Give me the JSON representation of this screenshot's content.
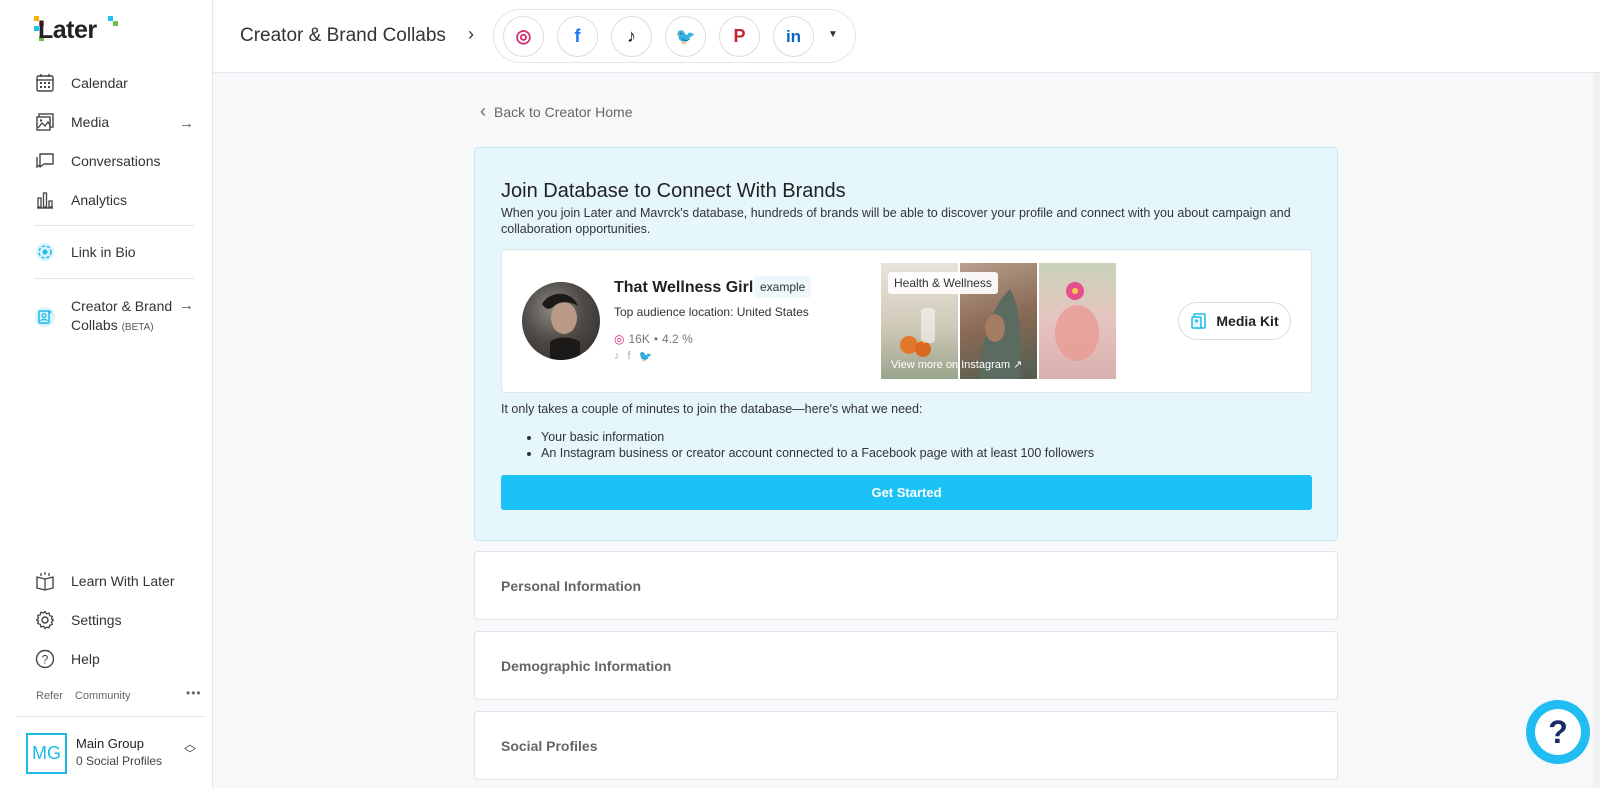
{
  "app": {
    "logo": "Later"
  },
  "sidebar": {
    "items": [
      {
        "label": "Calendar",
        "icon": "calendar-icon"
      },
      {
        "label": "Media",
        "icon": "media-icon"
      },
      {
        "label": "Conversations",
        "icon": "conversations-icon"
      },
      {
        "label": "Analytics",
        "icon": "analytics-icon"
      },
      {
        "label": "Link in Bio",
        "icon": "link-in-bio-icon"
      },
      {
        "label": "Creator & Brand",
        "label2": "Collabs",
        "badge": "(BETA)",
        "icon": "creator-collabs-icon"
      },
      {
        "label": "Learn With Later",
        "icon": "learn-icon"
      },
      {
        "label": "Settings",
        "icon": "gear-icon"
      },
      {
        "label": "Help",
        "icon": "help-icon"
      }
    ],
    "footer_links": [
      "Refer",
      "Community"
    ],
    "group": {
      "initials": "MG",
      "name": "Main Group",
      "profiles": "0 Social Profiles"
    }
  },
  "header": {
    "title": "Creator & Brand Collabs",
    "socials": [
      "instagram",
      "facebook",
      "tiktok",
      "twitter",
      "pinterest",
      "linkedin"
    ],
    "social_glyphs": [
      "◎",
      "f",
      "♪",
      "🐦",
      "P",
      "in"
    ]
  },
  "main": {
    "back_label": "Back to Creator Home",
    "card": {
      "title": "Join Database to Connect With Brands",
      "description": "When you join Later and Mavrck's database, hundreds of brands will be able to discover your profile and connect with you about campaign and collaboration opportunities.",
      "example": {
        "name": "That Wellness Girl",
        "tag": "example",
        "location": "Top audience location: United States",
        "followers": "16K",
        "engagement": "4.2 %",
        "thumb_tag": "Health & Wellness",
        "thumb_more": "View more on Instagram ↗",
        "media_kit_label": "Media Kit"
      },
      "need_intro": "It only takes a couple of minutes to join the database—here's what we need:",
      "requirements": [
        "Your basic information",
        "An Instagram business or creator account connected to a Facebook page with at least 100 followers"
      ],
      "cta": "Get Started"
    },
    "sections": [
      "Personal Information",
      "Demographic Information",
      "Social Profiles"
    ]
  },
  "colors": {
    "accent": "#1cc1f6",
    "card_bg": "#e5f6fc",
    "help_fab": "#1fbdf2"
  }
}
